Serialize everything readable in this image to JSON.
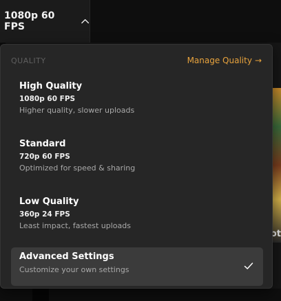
{
  "topbar": {
    "quality_button_label": "1080p 60 FPS",
    "chevron_icon": "chevron-up-icon"
  },
  "menu": {
    "section_label": "QUALITY",
    "manage_link": {
      "label": "Manage Quality",
      "arrow": "→",
      "color": "#e8a33d"
    },
    "options": [
      {
        "title": "High Quality",
        "spec": "1080p 60 FPS",
        "description": "Higher quality, slower uploads",
        "selected": false
      },
      {
        "title": "Standard",
        "spec": "720p 60 FPS",
        "description": "Optimized for speed & sharing",
        "selected": false
      },
      {
        "title": "Low Quality",
        "spec": "360p 24 FPS",
        "description": "Least impact, fastest uploads",
        "selected": false
      },
      {
        "title": "Advanced Settings",
        "description": "Customize your own settings",
        "selected": true,
        "selected_icon": "checkmark-icon"
      }
    ]
  },
  "background": {
    "partial_text": "ot"
  }
}
